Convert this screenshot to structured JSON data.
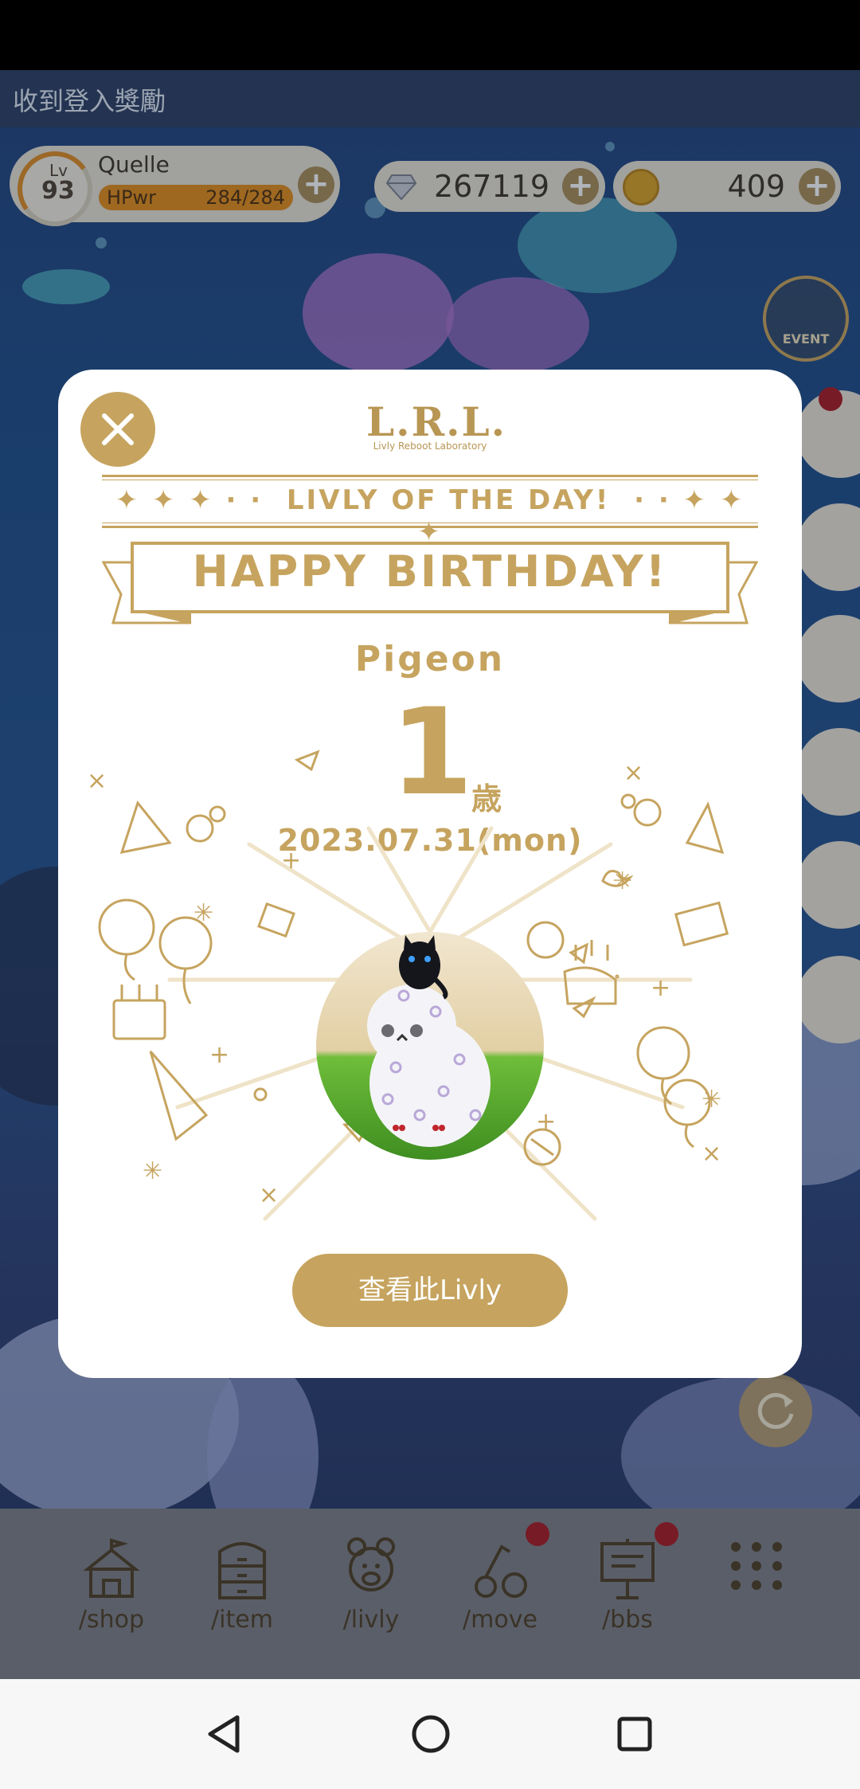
{
  "notification": {
    "text": "收到登入獎勵"
  },
  "user": {
    "level_label": "Lv",
    "level": "93",
    "name": "Quelle",
    "hp_label": "HPwr",
    "hp_value": "284/284"
  },
  "currency": {
    "gems": "267119",
    "coins": "409"
  },
  "side": {
    "event_label": "EVENT"
  },
  "modal": {
    "logo": "L.R.L.",
    "logo_sub": "Livly Reboot Laboratory",
    "livly_of_the_day": "LIVLY OF THE DAY!",
    "banner": "HAPPY BIRTHDAY!",
    "livly_name": "Pigeon",
    "age": "1",
    "age_unit": "歳",
    "date": "2023.07.31(mon)",
    "view_button": "查看此Livly"
  },
  "tabs": [
    {
      "label": "/shop"
    },
    {
      "label": "/item"
    },
    {
      "label": "/livly"
    },
    {
      "label": "/move"
    },
    {
      "label": "/bbs"
    }
  ],
  "colors": {
    "gold": "#c6a45f",
    "tabbar": "#7c7c80",
    "badge": "#a8141b"
  }
}
